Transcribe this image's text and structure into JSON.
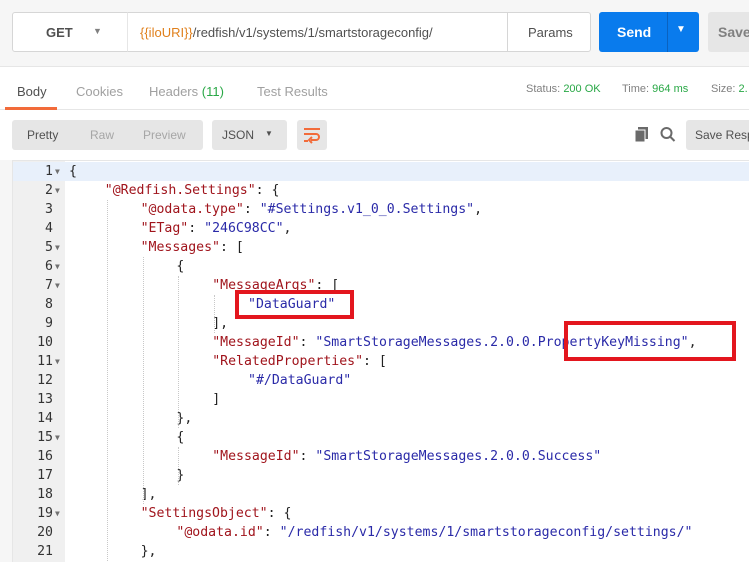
{
  "request": {
    "method": "GET",
    "url_variable": "{{iloURI}}",
    "url_path": "/redfish/v1/systems/1/smartstorageconfig/",
    "params_label": "Params",
    "send_label": "Send",
    "save_label": "Save"
  },
  "response_tabs": {
    "body": "Body",
    "cookies": "Cookies",
    "headers": "Headers",
    "headers_count": "(11)",
    "test_results": "Test Results"
  },
  "status": {
    "status_label": "Status:",
    "status_value": "200 OK",
    "time_label": "Time:",
    "time_value": "964 ms",
    "size_label": "Size:",
    "size_value": "2."
  },
  "toolbar": {
    "pretty": "Pretty",
    "raw": "Raw",
    "preview": "Preview",
    "format": "JSON",
    "save_response": "Save Resp"
  },
  "code_lines": [
    {
      "n": "1",
      "tokens": [
        {
          "t": "{",
          "c": "p"
        }
      ]
    },
    {
      "n": "2",
      "tokens": [
        {
          "t": "\"@Redfish.Settings\"",
          "c": "k"
        },
        {
          "t": ": {",
          "c": "p"
        }
      ]
    },
    {
      "n": "3",
      "tokens": [
        {
          "t": "\"@odata.type\"",
          "c": "k"
        },
        {
          "t": ": ",
          "c": "p"
        },
        {
          "t": "\"#Settings.v1_0_0.Settings\"",
          "c": "s"
        },
        {
          "t": ",",
          "c": "p"
        }
      ]
    },
    {
      "n": "4",
      "tokens": [
        {
          "t": "\"ETag\"",
          "c": "k"
        },
        {
          "t": ": ",
          "c": "p"
        },
        {
          "t": "\"246C98CC\"",
          "c": "s"
        },
        {
          "t": ",",
          "c": "p"
        }
      ]
    },
    {
      "n": "5",
      "tokens": [
        {
          "t": "\"Messages\"",
          "c": "k"
        },
        {
          "t": ": [",
          "c": "p"
        }
      ]
    },
    {
      "n": "6",
      "tokens": [
        {
          "t": "{",
          "c": "p"
        }
      ]
    },
    {
      "n": "7",
      "tokens": [
        {
          "t": "\"MessageArgs\"",
          "c": "k"
        },
        {
          "t": ": [",
          "c": "p"
        }
      ]
    },
    {
      "n": "8",
      "tokens": [
        {
          "t": "\"DataGuard\"",
          "c": "s"
        }
      ]
    },
    {
      "n": "9",
      "tokens": [
        {
          "t": "],",
          "c": "p"
        }
      ]
    },
    {
      "n": "10",
      "tokens": [
        {
          "t": "\"MessageId\"",
          "c": "k"
        },
        {
          "t": ": ",
          "c": "p"
        },
        {
          "t": "\"SmartStorageMessages.2.0.0.PropertyKeyMissing\"",
          "c": "s"
        },
        {
          "t": ",",
          "c": "p"
        }
      ]
    },
    {
      "n": "11",
      "tokens": [
        {
          "t": "\"RelatedProperties\"",
          "c": "k"
        },
        {
          "t": ": [",
          "c": "p"
        }
      ]
    },
    {
      "n": "12",
      "tokens": [
        {
          "t": "\"#/DataGuard\"",
          "c": "s"
        }
      ]
    },
    {
      "n": "13",
      "tokens": [
        {
          "t": "]",
          "c": "p"
        }
      ]
    },
    {
      "n": "14",
      "tokens": [
        {
          "t": "},",
          "c": "p"
        }
      ]
    },
    {
      "n": "15",
      "tokens": [
        {
          "t": "{",
          "c": "p"
        }
      ]
    },
    {
      "n": "16",
      "tokens": [
        {
          "t": "\"MessageId\"",
          "c": "k"
        },
        {
          "t": ": ",
          "c": "p"
        },
        {
          "t": "\"SmartStorageMessages.2.0.0.Success\"",
          "c": "s"
        }
      ]
    },
    {
      "n": "17",
      "tokens": [
        {
          "t": "}",
          "c": "p"
        }
      ]
    },
    {
      "n": "18",
      "tokens": [
        {
          "t": "],",
          "c": "p"
        }
      ]
    },
    {
      "n": "19",
      "tokens": [
        {
          "t": "\"SettingsObject\"",
          "c": "k"
        },
        {
          "t": ": {",
          "c": "p"
        }
      ]
    },
    {
      "n": "20",
      "tokens": [
        {
          "t": "\"@odata.id\"",
          "c": "k"
        },
        {
          "t": ": ",
          "c": "p"
        },
        {
          "t": "\"/redfish/v1/systems/1/smartstorageconfig/settings/\"",
          "c": "s"
        }
      ]
    },
    {
      "n": "21",
      "tokens": [
        {
          "t": "},",
          "c": "p"
        }
      ]
    }
  ],
  "colors": {
    "send_button": "#097bed",
    "active_tab_underline": "#f26b3a",
    "status_ok": "#29a846",
    "url_variable": "#e0801c",
    "json_key": "#a0141c",
    "json_string": "#2a2aa8",
    "highlight_box": "#e3161e"
  }
}
